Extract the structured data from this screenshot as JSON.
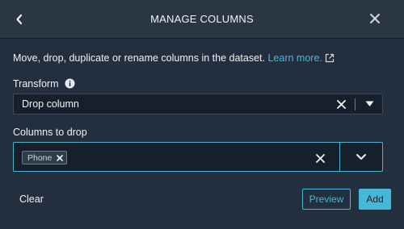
{
  "colors": {
    "background": "#232f3e",
    "header": "#2a3644",
    "input": "#16202c",
    "accent": "#44b9d6",
    "text": "#f2f3f3"
  },
  "header": {
    "title": "MANAGE COLUMNS",
    "back_icon": "chevron-left-icon",
    "close_icon": "close-icon"
  },
  "description": {
    "text": "Move, drop, duplicate or rename columns in the dataset.",
    "link": "Learn more.",
    "link_icon": "external-link-icon"
  },
  "transform": {
    "label": "Transform",
    "info_icon": "info-icon",
    "value": "Drop column"
  },
  "columns_to_drop": {
    "label": "Columns to drop",
    "tokens": [
      "Phone"
    ]
  },
  "footer": {
    "clear_label": "Clear",
    "preview_label": "Preview",
    "add_label": "Add"
  }
}
